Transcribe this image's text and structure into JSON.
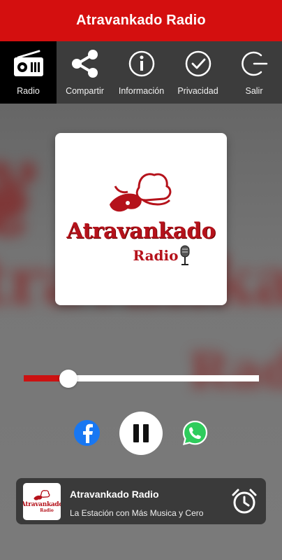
{
  "app": {
    "title": "Atravankado Radio"
  },
  "nav": {
    "items": [
      {
        "label": "Radio",
        "icon": "radio-icon"
      },
      {
        "label": "Compartir",
        "icon": "share-icon"
      },
      {
        "label": "Información",
        "icon": "info-icon"
      },
      {
        "label": "Privacidad",
        "icon": "check-circle-icon"
      },
      {
        "label": "Salir",
        "icon": "exit-icon"
      }
    ]
  },
  "artwork": {
    "brand": "Atravankado",
    "sub": "Radio"
  },
  "player": {
    "progress": 0.19,
    "state": "playing",
    "fill_color": "#cc1111"
  },
  "share": {
    "facebook_icon": "facebook-icon",
    "whatsapp_icon": "whatsapp-icon"
  },
  "now_playing": {
    "title": "Atravankado Radio",
    "subtitle": "La Estación con Más Musica y Cero",
    "thumb_brand": "Atravankado",
    "thumb_sub": "Radio"
  },
  "colors": {
    "header": "#d40f0f",
    "nav_bg": "#3c3c3c",
    "nav_active": "#000000",
    "accent": "#cc1111"
  }
}
